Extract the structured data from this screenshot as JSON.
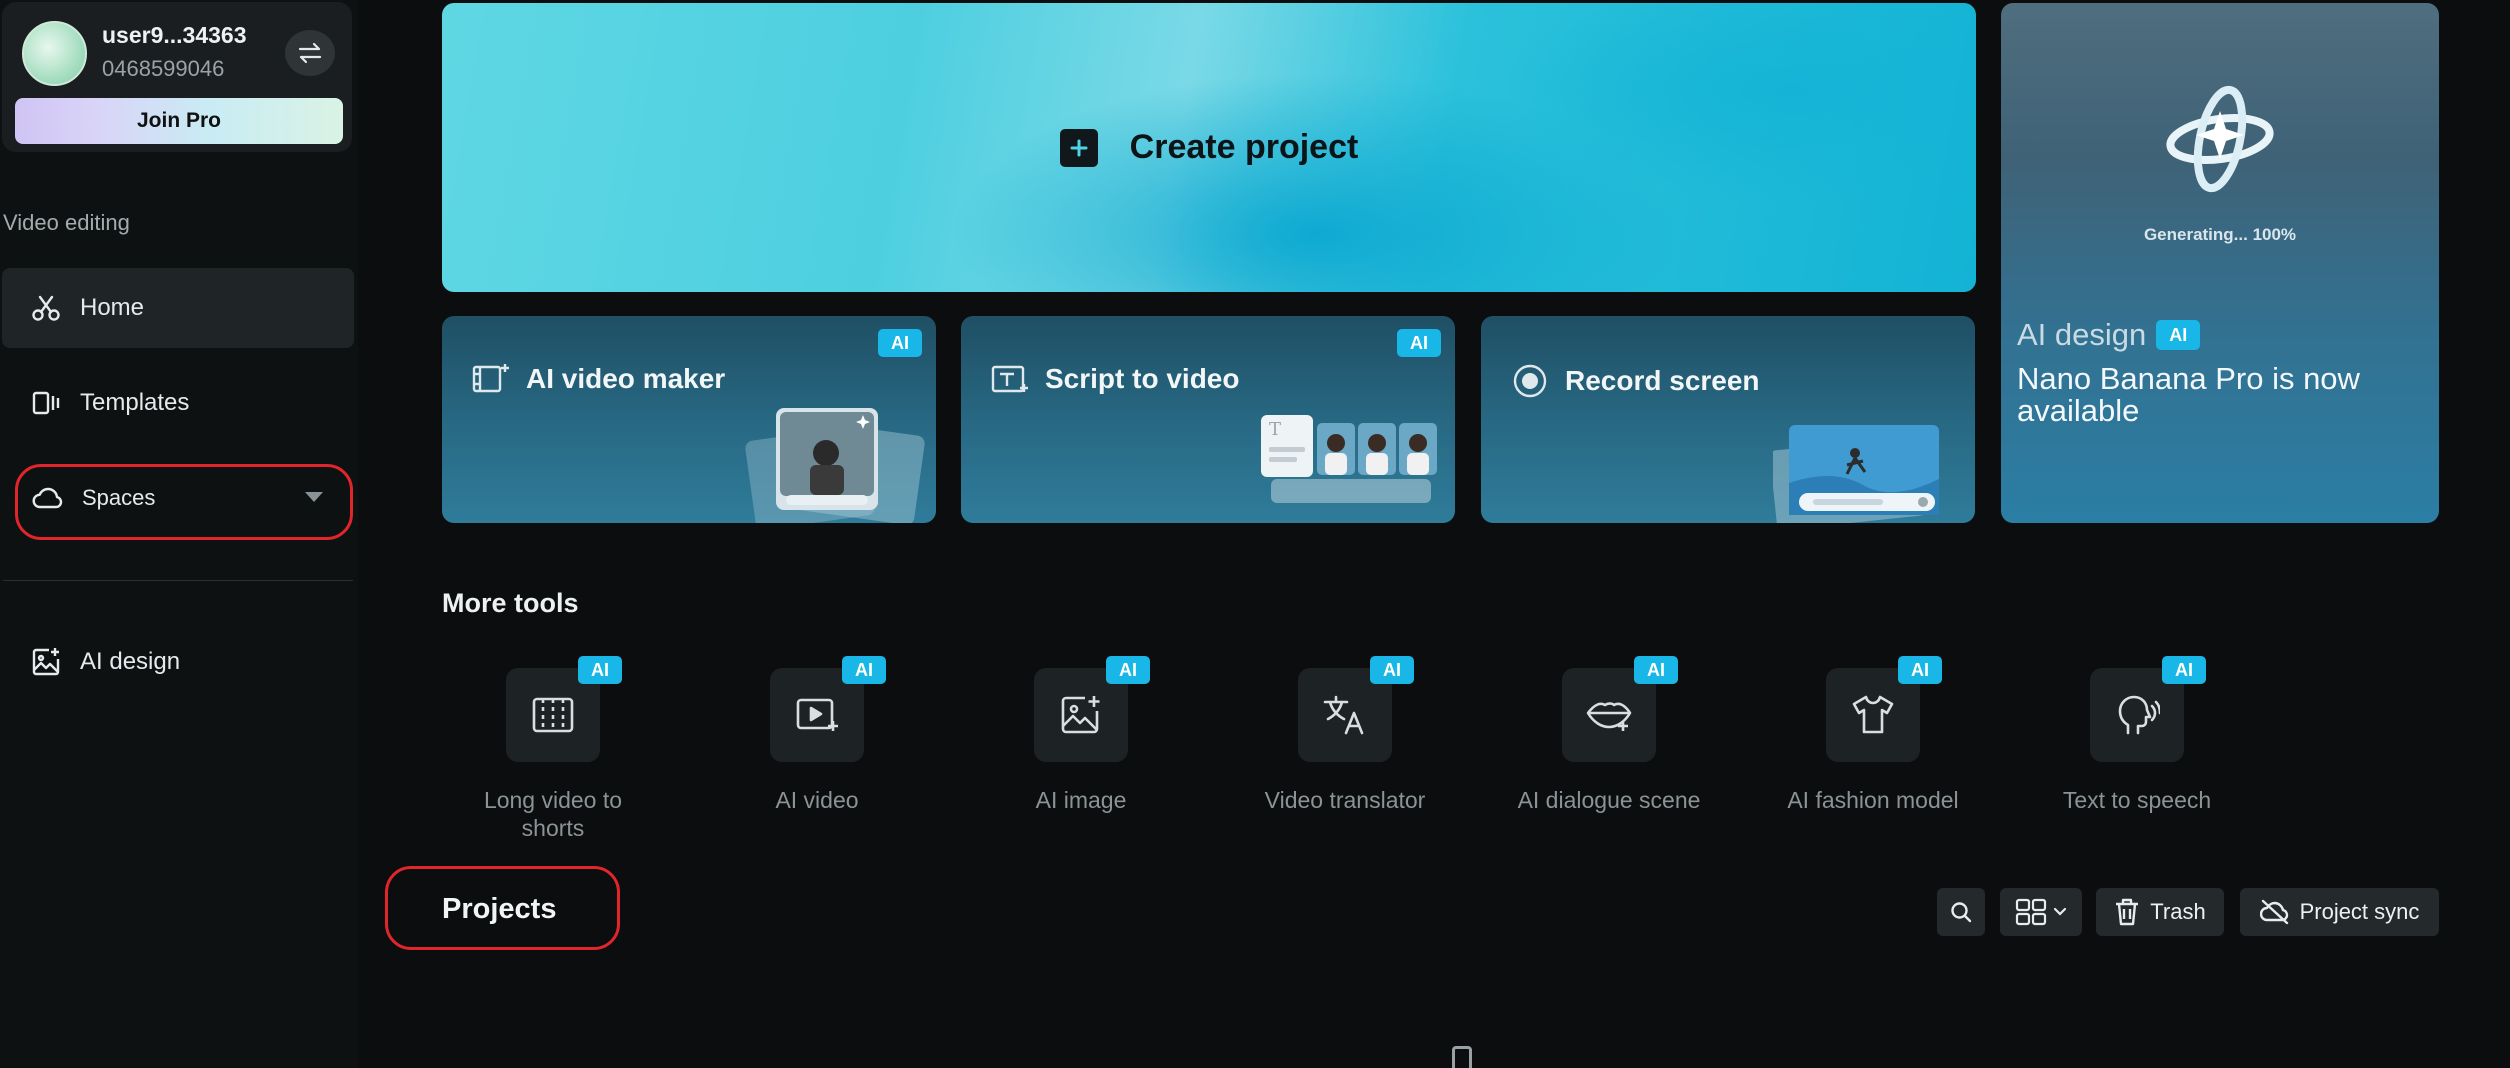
{
  "user": {
    "name": "user9...34363",
    "id": "0468599046",
    "join_pro_label": "Join Pro"
  },
  "sidebar": {
    "section_label": "Video editing",
    "items": [
      {
        "label": "Home",
        "icon": "scissors-icon",
        "active": true
      },
      {
        "label": "Templates",
        "icon": "templates-icon"
      },
      {
        "label": "Spaces",
        "icon": "cloud-icon"
      },
      {
        "label": "AI design",
        "icon": "image-sparkle-icon"
      }
    ]
  },
  "hero": {
    "label": "Create project"
  },
  "cards": [
    {
      "label": "AI video maker",
      "badge": "AI"
    },
    {
      "label": "Script to video",
      "badge": "AI"
    },
    {
      "label": "Record screen"
    }
  ],
  "promo": {
    "status": "Generating... 100%",
    "kicker": "AI design",
    "badge": "AI",
    "text": "Nano Banana Pro is now available"
  },
  "more_tools": {
    "title": "More tools",
    "badge": "AI",
    "items": [
      {
        "label": "Long video to shorts",
        "icon": "film-split-icon"
      },
      {
        "label": "AI video",
        "icon": "video-play-icon"
      },
      {
        "label": "AI image",
        "icon": "image-sparkle-icon"
      },
      {
        "label": "Video translator",
        "icon": "translate-icon"
      },
      {
        "label": "AI dialogue scene",
        "icon": "lips-icon"
      },
      {
        "label": "AI fashion model",
        "icon": "shirt-icon"
      },
      {
        "label": "Text to speech",
        "icon": "speaking-head-icon"
      }
    ]
  },
  "projects": {
    "title": "Projects",
    "trash_label": "Trash",
    "sync_label": "Project sync"
  },
  "colors": {
    "accent": "#19b7e8",
    "highlight_ring": "#e0262a",
    "background": "#0b0d0e"
  }
}
